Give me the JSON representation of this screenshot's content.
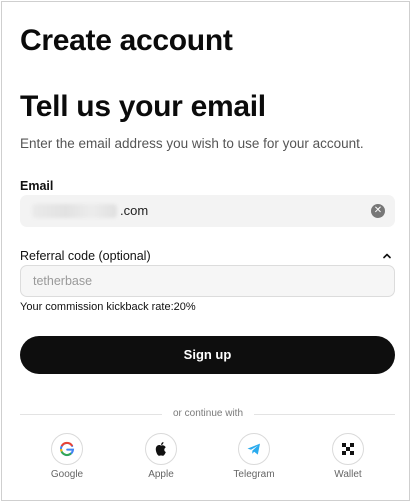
{
  "page_title": "Create account",
  "heading": "Tell us your email",
  "subtitle": "Enter the email address you wish to use for your account.",
  "email": {
    "label": "Email",
    "value_suffix": ".com",
    "clear_icon": "clear-x-icon"
  },
  "referral": {
    "label": "Referral code (optional)",
    "placeholder": "tetherbase",
    "toggle_icon": "chevron-up-icon",
    "commission_text": "Your commission kickback rate:20%"
  },
  "signup_button": "Sign up",
  "continue_with": "or continue with",
  "social": [
    {
      "label": "Google",
      "icon": "google-icon",
      "color": "#4285F4"
    },
    {
      "label": "Apple",
      "icon": "apple-icon",
      "color": "#111111"
    },
    {
      "label": "Telegram",
      "icon": "telegram-icon",
      "color": "#2AABEE"
    },
    {
      "label": "Wallet",
      "icon": "wallet-icon",
      "color": "#111111"
    }
  ],
  "colors": {
    "primary_button": "#0e0e0e",
    "field_background": "#f3f3f3"
  }
}
